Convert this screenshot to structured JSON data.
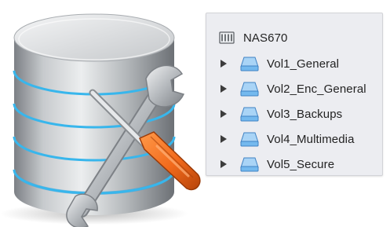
{
  "tree": {
    "root": {
      "label": "NAS670",
      "icon": "server-icon"
    },
    "volumes": [
      {
        "label": "Vol1_General",
        "icon": "drive-icon",
        "expanded": false
      },
      {
        "label": "Vol2_Enc_General",
        "icon": "drive-icon",
        "expanded": false
      },
      {
        "label": "Vol3_Backups",
        "icon": "drive-icon",
        "expanded": false
      },
      {
        "label": "Vol4_Multimedia",
        "icon": "drive-icon",
        "expanded": false
      },
      {
        "label": "Vol5_Secure",
        "icon": "drive-icon",
        "expanded": false
      }
    ]
  },
  "illustration": {
    "subject": "database-cylinder-with-wrench-and-screwdriver",
    "colors": {
      "database_body": "#b9bcbf",
      "accent_glow": "#38b6ec",
      "wrench": "#c4c8cc",
      "screwdriver_handle": "#f26a1c"
    }
  },
  "colors": {
    "panel_background": "#ecedf1",
    "text": "#232323",
    "drive_icon": "#74b9ee"
  }
}
